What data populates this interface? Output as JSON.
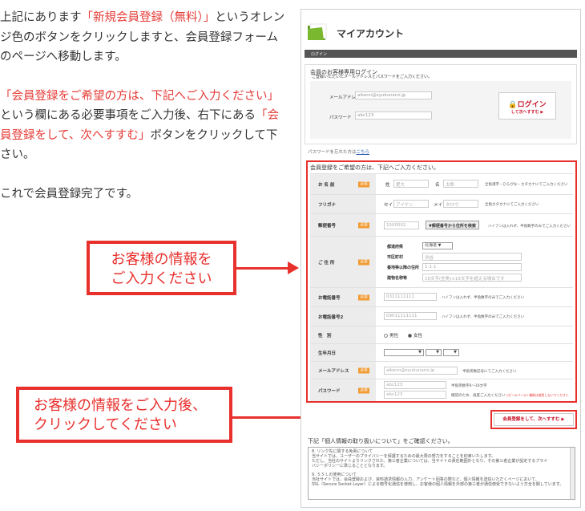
{
  "intro": {
    "p1_a": "上記にあります",
    "p1_red": "「新規会員登録（無料）」",
    "p1_b": "というオレンジ色のボタンをクリックしますと、会員登録フォームのページへ移動します。",
    "p2_red1": "「会員登録をご希望の方は、下記へご入力ください」",
    "p2_a": "という欄にある必要事項をご入力後、右下にある",
    "p2_red2": "「会員登録をして、次へすすむ」",
    "p2_b": "ボタンをクリックして下さい。",
    "p3": "これで会員登録完了です。"
  },
  "callouts": {
    "first": "お客様の情報を\nご入力ください",
    "second": "お客様の情報をご入力後、\nクリックしてください"
  },
  "panel": {
    "title": "マイアカウント",
    "login_tab": "ログイン",
    "login_box_title": "会員のお客様専用ログイン",
    "login_desc": "ご登録いただいたメールアドレスとパスワードをご入力ください。",
    "email_label": "メールアドレス",
    "email_value": "aikenn@syukunami.jp",
    "password_label": "パスワード",
    "password_value": "abc123",
    "login_button_main": "ログイン",
    "login_button_sub": "して次へすすむ ▶",
    "forgot_text": "パスワードを忘れた方は",
    "forgot_link": "こちら"
  },
  "register": {
    "title": "会員登録をご希望の方は、下記へご入力ください。",
    "required_badge": "必須",
    "name": {
      "label": "お 名 前",
      "sei": "姓",
      "sei_ph": "愛大",
      "mei": "名",
      "mei_ph": "太郎",
      "note": "全角漢字・ひらがな・カタカナにてご入力ください"
    },
    "kana": {
      "label": "フリガナ",
      "sei": "セイ",
      "sei_ph": "アイケン",
      "mei": "メイ",
      "mei_ph": "タロウ",
      "note": "全角カタカナにてご入力ください"
    },
    "zip": {
      "label": "郵便番号",
      "value": "1500002",
      "button": "▼郵便番号から住所を検索",
      "note": "ハイフンは入れず、半角数字のみでご入力ください"
    },
    "address": {
      "label": "ご 住 所",
      "pref_label": "都道府県",
      "pref_value": "北海道",
      "city_label": "市区町村",
      "city_value": "渋谷",
      "street_label": "番地等以降の住所",
      "street_value": "1-1-1",
      "building_label": "建物名称等",
      "building_value": "16文字(全角)×16文字を超える場合です"
    },
    "phone": {
      "label": "お電話番号",
      "value": "0311111111",
      "note": "ハイフンは入れず、半角数字のみでご入力ください"
    },
    "phone2": {
      "label": "お電話番号2",
      "value": "09011111111",
      "note": "ハイフンは入れず、半角数字のみでご入力ください"
    },
    "gender": {
      "label": "性　別",
      "male": "男性",
      "female": "女性"
    },
    "birthday": {
      "label": "生年月日"
    },
    "email": {
      "label": "メールアドレス",
      "value": "aikenn@syukunami.jp",
      "note": "半角英数記号にてご入力ください"
    },
    "password": {
      "label": "パスワード",
      "value1": "abc123",
      "value2": "abc123",
      "note1": "半角英数字6〜16文字",
      "note2": "確認のため、再度ご入力ください",
      "warn": "コピー&ペースト機能は使用しないでください"
    }
  },
  "submit_button": "会員登録をして、次へすすむ ▶",
  "privacy": {
    "title": "下記「個人情報の取り扱いについて」をご確認ください。",
    "line1": "8. リンク先に関する免責について",
    "line2": "当サイトでは、ユーザーのプライバシーを保護するための最大限の努力をすることを約束いたします。",
    "line3": "ただし、当社のサイトよりリンクされた、第三者企業については、当サイトの責任範囲外となり、その第三者企業が設定するプライ",
    "line4": "バシーポリシーに準じることとなります。",
    "line5": "9. ＳＳＬの使用について",
    "line6": "当社サイトでは、会員登録および、資料請求情報の入力、アンケート回答の際など、個人情報を送信いただくページにおいて、",
    "line7": "SSL（Secure Socket Layer）による暗号化通信を使用し、お客様の個人情報を外部の第三者が通信傍受できないよう万全を期しています。"
  },
  "colors": {
    "accent_red": "#e8302d",
    "required_orange": "#f29b33",
    "folder_green": "#7ab830"
  }
}
